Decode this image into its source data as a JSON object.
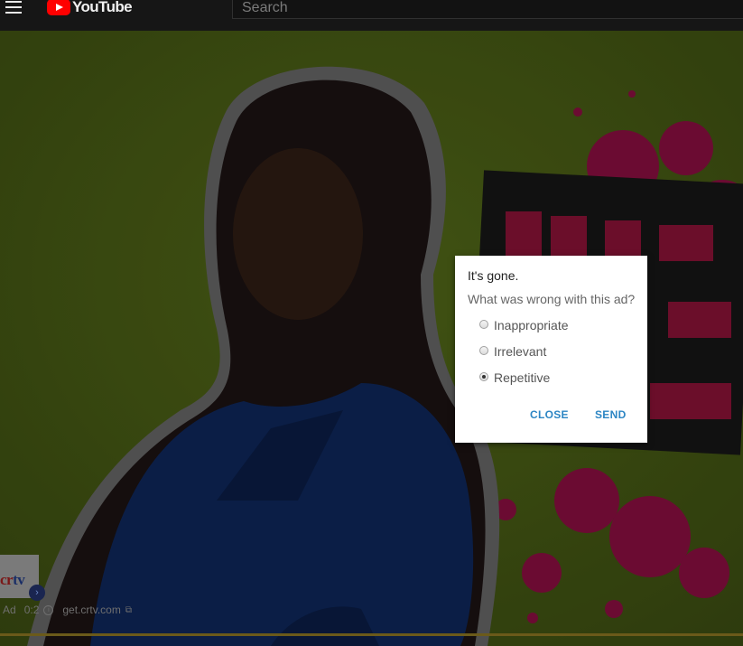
{
  "header": {
    "logo_text": "YouTube",
    "search_placeholder": "Search"
  },
  "dialog": {
    "title": "It's gone.",
    "question": "What was wrong with this ad?",
    "options": [
      {
        "label": "Inappropriate",
        "checked": false
      },
      {
        "label": "Irrelevant",
        "checked": false
      },
      {
        "label": "Repetitive",
        "checked": true
      }
    ],
    "close_label": "CLOSE",
    "send_label": "SEND"
  },
  "ad_info": {
    "brand_a": "cr",
    "brand_b": "tv",
    "ad_label": "Ad",
    "time": "0:2",
    "url": "get.crtv.com"
  },
  "colors": {
    "background_green": "#3c4d12",
    "accent_blue": "#2d86c4",
    "splatter_pink": "#c0135a"
  }
}
